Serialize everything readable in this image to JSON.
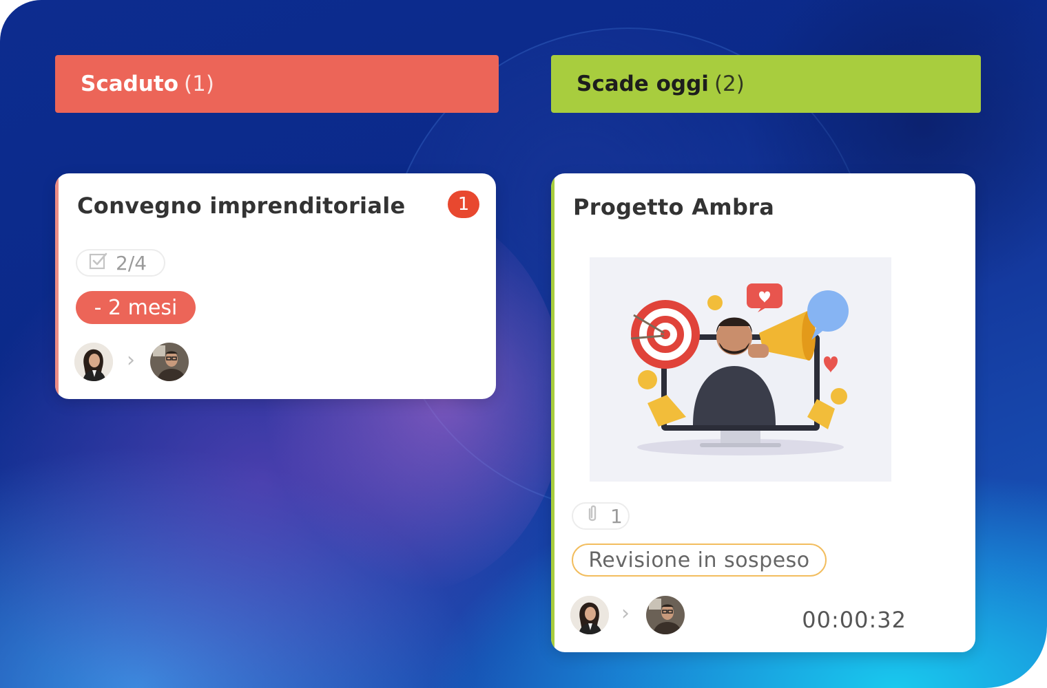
{
  "columns": [
    {
      "header": {
        "title": "Scaduto",
        "count": "(1)",
        "color": "#ec6558"
      },
      "cards": [
        {
          "title": "Convegno imprenditoriale",
          "notification_count": "1",
          "checklist": "2/4",
          "due": "- 2 mesi",
          "accent": "#ec8d84"
        }
      ]
    },
    {
      "header": {
        "title": "Scade oggi",
        "count": "(2)",
        "color": "#a8cd3e"
      },
      "cards": [
        {
          "title": "Progetto Ambra",
          "cover_image": "marketing-megaphone-illustration",
          "attachments": "1",
          "status": "Revisione in sospeso",
          "timer": "00:00:32",
          "accent": "#a8cd3e"
        }
      ]
    }
  ],
  "icons": {
    "checklist": "checkbox-icon",
    "attachment": "paperclip-icon",
    "arrow": "chevron-right-icon",
    "assigner": "avatar-woman",
    "assignee": "avatar-man"
  }
}
